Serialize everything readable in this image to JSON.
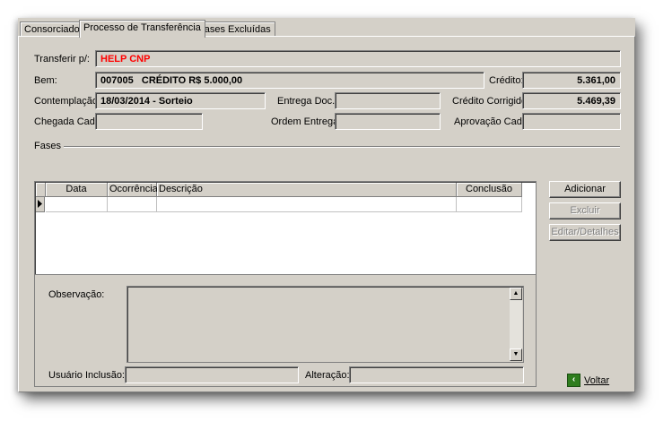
{
  "tabs": [
    "Consorciado",
    "Processo de Transferência",
    "Fases Excluídas"
  ],
  "form": {
    "transferir_label": "Transferir p/:",
    "transferir_value": "HELP CNP",
    "bem_label": "Bem:",
    "bem_value": "007005   CRÉDITO R$ 5.000,00",
    "credito_label": "Crédito:",
    "credito_value": "5.361,00",
    "contemplacao_label": "Contemplação:",
    "contemplacao_value": "18/03/2014 - Sorteio",
    "entrega_doc_label": "Entrega Doc.:",
    "entrega_doc_value": "",
    "credito_corrigido_label": "Crédito Corrigido:",
    "credito_corrigido_value": "5.469,39",
    "chegada_cad_label": "Chegada Cad.",
    "chegada_cad_value": "",
    "ordem_entrega_label": "Ordem Entrega:",
    "ordem_entrega_value": "",
    "aprovacao_cad_label": "Aprovação Cad.:",
    "aprovacao_cad_value": ""
  },
  "fases": {
    "group_label": "Fases",
    "columns": [
      "Data",
      "Ocorrência",
      "Descrição",
      "Conclusão"
    ]
  },
  "observacao": {
    "label": "Observação:",
    "value": "",
    "usuario_inclusao_label": "Usuário Inclusão:",
    "usuario_inclusao_value": "",
    "alteracao_label": "Alteração:",
    "alteracao_value": ""
  },
  "buttons": {
    "adicionar": "Adicionar",
    "excluir": "Excluir",
    "editar_detalhes": "Editar/Detalhes",
    "voltar": "Voltar"
  },
  "colors": {
    "window_bg": "#d4d0c8",
    "highlight_red": "#ff0000",
    "voltar_icon_green": "#2f7d1e"
  },
  "icons": {
    "row_indicator": "triangle-right-icon",
    "scroll_up": "arrow-up-icon",
    "scroll_down": "arrow-down-icon",
    "voltar": "back-arrow-icon"
  }
}
